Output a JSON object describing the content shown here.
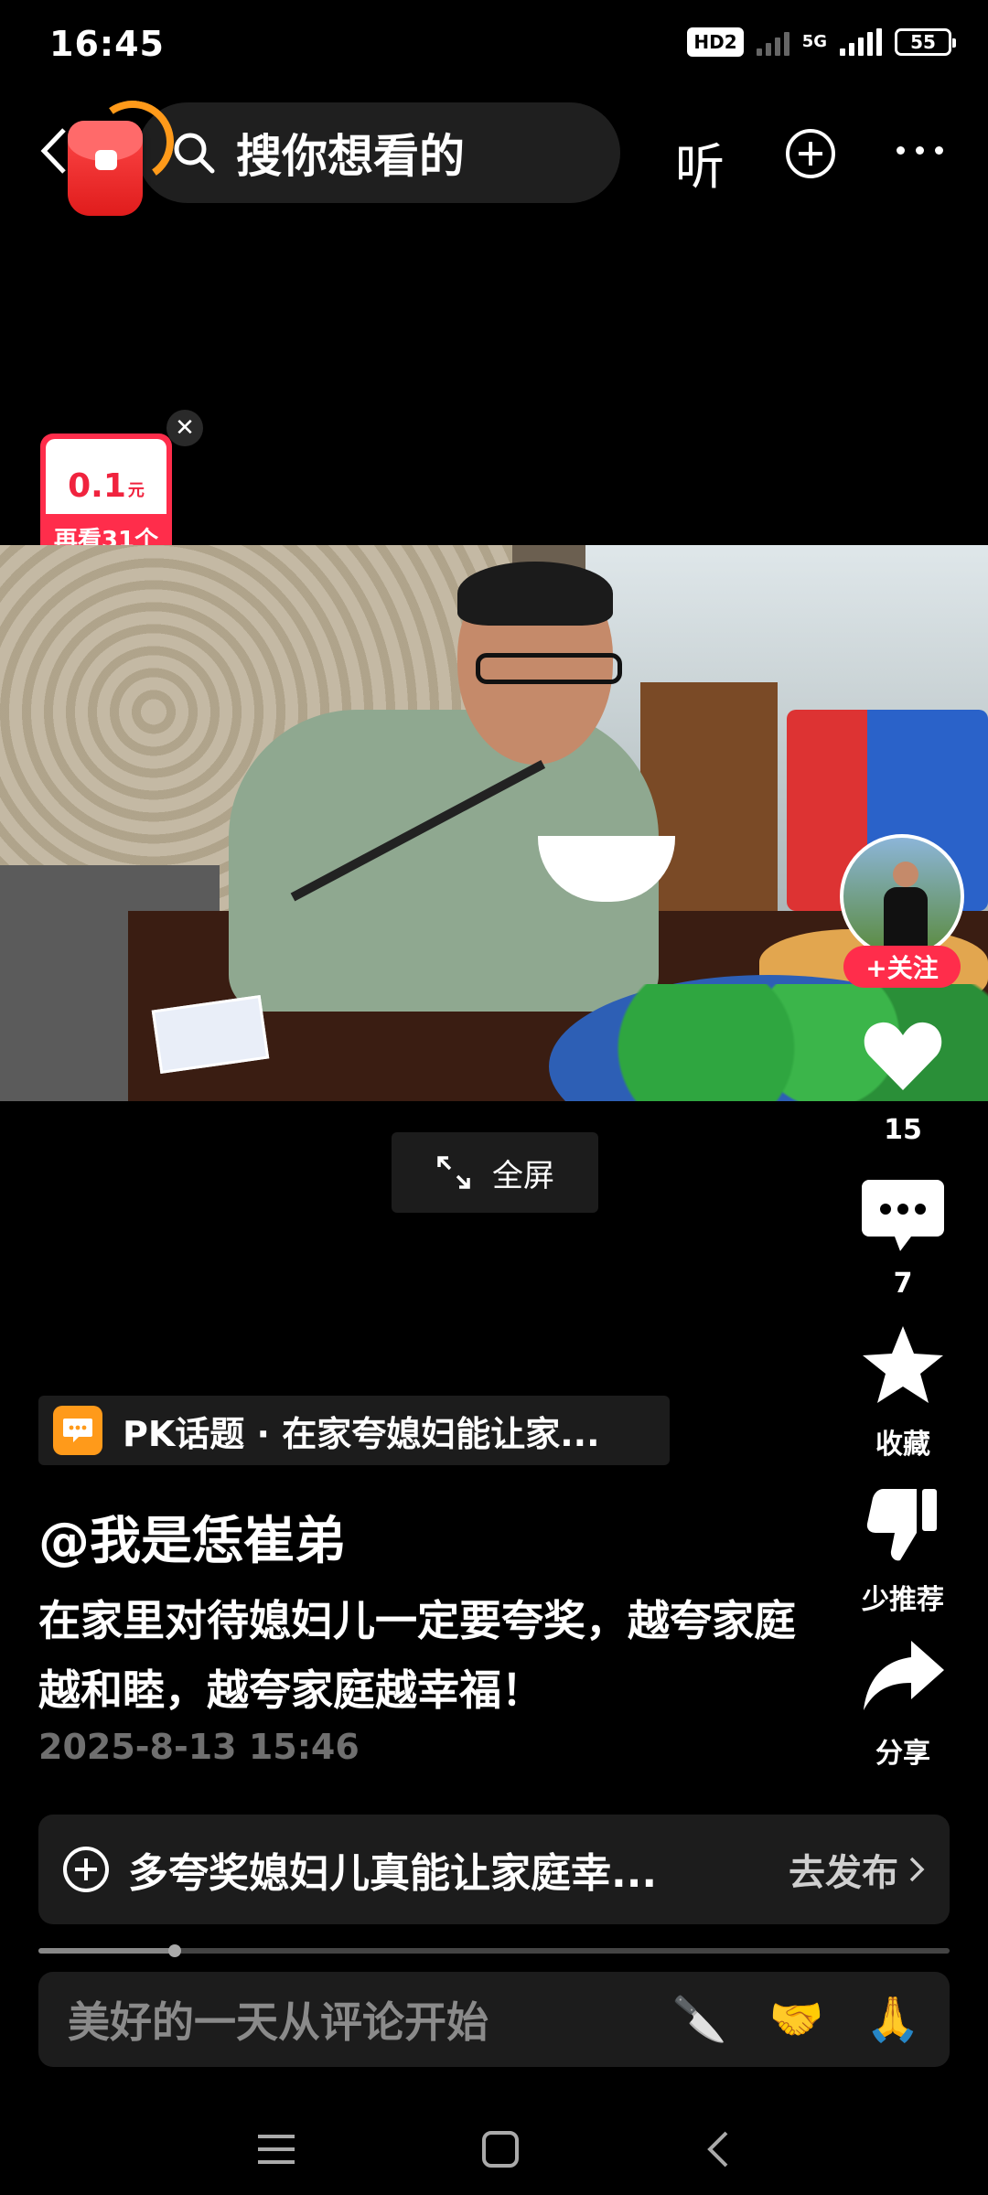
{
  "status_bar": {
    "time": "16:45",
    "hd": "HD2",
    "network": "5G",
    "battery": "55"
  },
  "top_bar": {
    "search_placeholder": "搜你想看的",
    "listen_label": "听"
  },
  "reward": {
    "amount": "0.1",
    "unit": "元",
    "subtitle": "再看31个"
  },
  "video": {
    "fullscreen_label": "全屏"
  },
  "side_actions": {
    "follow_label": "+关注",
    "like_count": "15",
    "comment_count": "7",
    "favorite_label": "收藏",
    "dislike_label": "少推荐",
    "share_label": "分享"
  },
  "post": {
    "topic": "PK话题 · 在家夸媳妇能让家...",
    "author": "@我是恁崔弟",
    "description": "在家里对待媳妇儿一定要夸奖，越夸家庭越和睦，越夸家庭越幸福！",
    "date": "2025-8-13 15:46"
  },
  "publish_bar": {
    "text": "多夸奖媳妇儿真能让家庭幸...",
    "button": "去发布"
  },
  "playback": {
    "progress_fraction": 0.15
  },
  "comment_bar": {
    "placeholder": "美好的一天从评论开始",
    "emojis": [
      "🔪",
      "🤝",
      "🙏"
    ]
  },
  "colors": {
    "accent_red": "#ff2d4b",
    "topic_orange": "#ff9a1a",
    "background": "#000000"
  }
}
